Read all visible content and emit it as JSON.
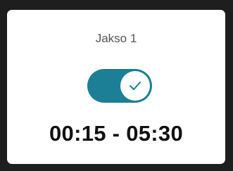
{
  "card": {
    "title": "Jakso 1",
    "toggle": {
      "state": "on",
      "active_color": "#1c7f95",
      "knob_icon": "check-icon"
    },
    "time_range": "00:15 - 05:30"
  }
}
